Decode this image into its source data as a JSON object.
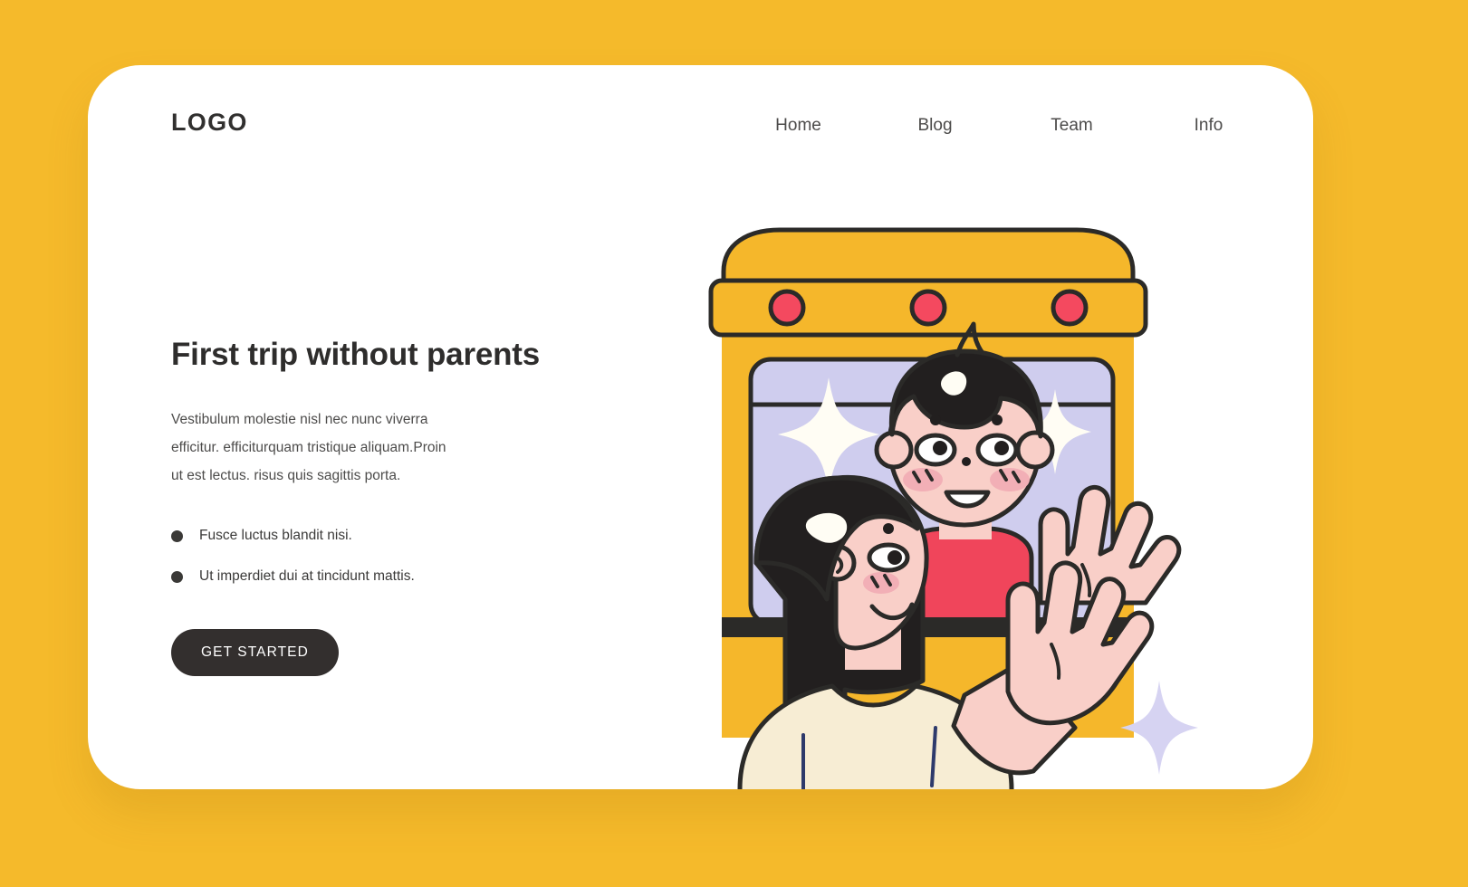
{
  "theme": {
    "background": "#F5BA2B",
    "card_background": "#FFFFFF",
    "text_dark": "#2E2D2C",
    "button_background": "#332F2E",
    "button_text": "#FFFFFF",
    "bus_yellow": "#F5B72B",
    "bus_outline": "#2B2A28",
    "window_lavender": "#CFCDEE",
    "boy_shirt_red": "#F0455B",
    "girl_shirt_cream": "#F7EDD4",
    "skin": "#F9CFC8",
    "light_red": "#F4495F"
  },
  "header": {
    "logo": "LOGO",
    "nav": [
      {
        "label": "Home"
      },
      {
        "label": "Blog"
      },
      {
        "label": "Team"
      },
      {
        "label": "Info"
      }
    ]
  },
  "hero": {
    "title": "First trip without parents",
    "paragraph": "Vestibulum molestie nisl nec nunc viverra efficitur. efficiturquam tristique aliquam.Proin ut est lectus. risus quis sagittis porta.",
    "bullets": [
      {
        "label": "Fusce luctus blandit nisi."
      },
      {
        "label": "Ut imperdiet dui at tincidunt mattis."
      }
    ],
    "cta_label": "GET STARTED"
  },
  "illustration": {
    "name": "school-bus-with-waving-children",
    "elements": {
      "bus_roof_lights_count": 3,
      "sparkles_in_window": 2,
      "sparkle_outside": 1,
      "boy": "boy-waving-from-bus-window",
      "girl": "girl-waving-outside-bus"
    }
  }
}
